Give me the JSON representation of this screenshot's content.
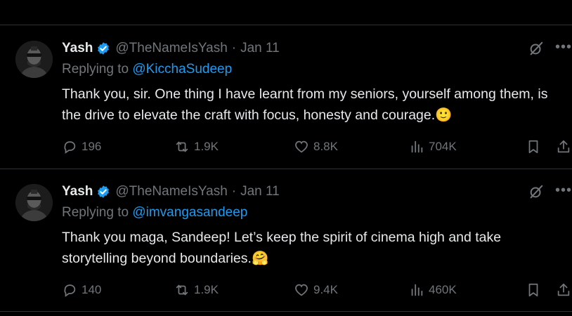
{
  "tweets": [
    {
      "author_name": "Yash",
      "handle": "@TheNameIsYash",
      "separator": "·",
      "date": "Jan 11",
      "replying_prefix": "Replying to",
      "replying_to": "@KicchaSudeep",
      "text": "Thank you, sir.  One thing I have learnt from my seniors, yourself among them, is the drive to elevate the craft with focus, honesty and courage.",
      "emoji": "🙂",
      "emoji_icon": "slightly-smiling-face-emoji",
      "replies": "196",
      "reposts": "1.9K",
      "likes": "8.8K",
      "views": "704K"
    },
    {
      "author_name": "Yash",
      "handle": "@TheNameIsYash",
      "separator": "·",
      "date": "Jan 11",
      "replying_prefix": "Replying to",
      "replying_to": "@imvangasandeep",
      "text": "Thank you maga, Sandeep! Let’s keep the spirit of cinema high and take storytelling beyond boundaries.",
      "emoji": "🤗",
      "emoji_icon": "hugging-face-emoji",
      "replies": "140",
      "reposts": "1.9K",
      "likes": "9.4K",
      "views": "460K"
    }
  ],
  "colors": {
    "background": "#000000",
    "text": "#e7e9ea",
    "muted": "#71767b",
    "link": "#1d9bf0",
    "divider": "#2f3336"
  }
}
